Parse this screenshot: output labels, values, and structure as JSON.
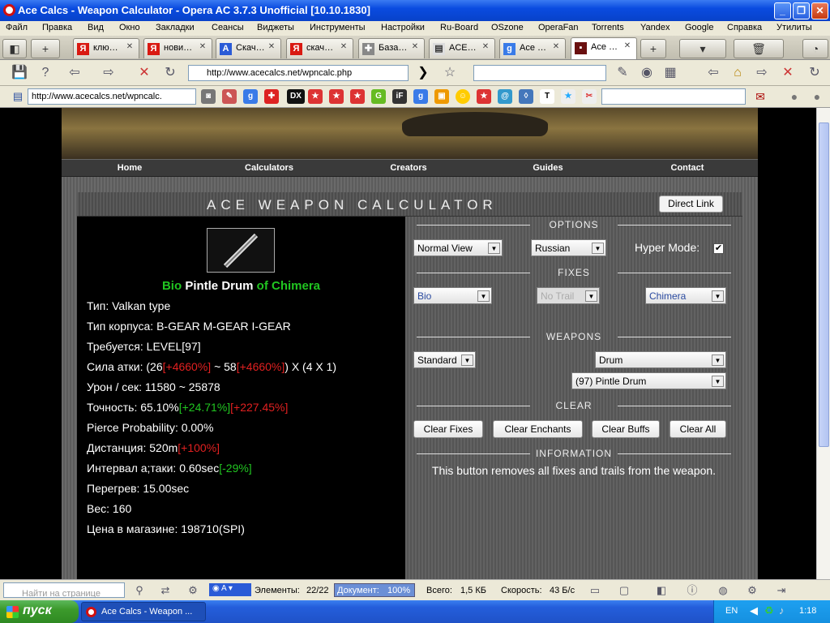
{
  "window": {
    "title": "Ace Calcs - Weapon Calculator - Opera AC 3.7.3 Unofficial [10.10.1830]"
  },
  "menu": [
    "Файл",
    "Правка",
    "Вид",
    "Окно",
    "Закладки",
    "Сеансы",
    "Виджеты",
    "Инструменты",
    "Настройки",
    "Ru-Board",
    "OSzone",
    "OperaFan",
    "Torrents",
    "Yandex",
    "Google",
    "Справка",
    "Утилиты"
  ],
  "tabs": [
    {
      "label": "клю…"
    },
    {
      "label": "нови…"
    },
    {
      "label": "Скач…"
    },
    {
      "label": "скач…"
    },
    {
      "label": "База…"
    },
    {
      "label": "ACE…"
    },
    {
      "label": "Ace …"
    },
    {
      "label": "Ace …"
    }
  ],
  "nav": {
    "url": "http://www.acecalcs.net/wpncalc.php",
    "search_value": ""
  },
  "linkbar": {
    "url": "http://www.acecalcs.net/wpncalc."
  },
  "site_nav": [
    "Home",
    "Calculators",
    "Creators",
    "Guides",
    "Contact"
  ],
  "calc": {
    "title": "ACE WEAPON CALCULATOR",
    "direct_link": "Direct Link"
  },
  "item": {
    "prefix": "Bio",
    "name": "Pintle Drum",
    "suffix": "of Chimera",
    "lines": {
      "type": "Тип: Valkan type",
      "hull": "Тип корпуса: B-GEAR M-GEAR I-GEAR",
      "req": "Требуется: LEVEL[97]",
      "atk_a": "Сила атки: (26",
      "atk_b": "[+4660%]",
      "atk_c": " ~ 58",
      "atk_d": "[+4660%]",
      "atk_e": ") X (4 X 1)",
      "dps": "Урон / сек: 11580 ~ 25878",
      "acc_a": "Точность: 65.10%",
      "acc_b": "[+24.71%]",
      "acc_c": "[+227.45%]",
      "pierce": "Pierce Probability: 0.00%",
      "range_a": "Дистанция: 520m",
      "range_b": "[+100%]",
      "int_a": "Интервал а;таки: 0.60sec",
      "int_b": "[-29%]",
      "over": "Перегрев: 15.00sec",
      "weight": "Вес: 160",
      "price": "Цена в магазине: 198710(SPI)"
    }
  },
  "options": {
    "section": "OPTIONS",
    "view": "Normal View",
    "lang": "Russian",
    "hyper_label": "Hyper Mode:"
  },
  "fixes": {
    "section": "FIXES",
    "prefix": "Bio",
    "trail": "No Trail",
    "suffix": "Chimera"
  },
  "weapons": {
    "section": "WEAPONS",
    "grade": "Standard",
    "class": "Drum",
    "weapon": "(97) Pintle Drum"
  },
  "clear": {
    "section": "CLEAR",
    "fixes": "Clear Fixes",
    "enchants": "Clear Enchants",
    "buffs": "Clear Buffs",
    "all": "Clear All"
  },
  "info": {
    "section": "INFORMATION",
    "text": "This button removes all fixes and trails from the weapon."
  },
  "status": {
    "find_placeholder": "Найти на странице",
    "elements_label": "Элементы:",
    "elements": "22/22",
    "doc_label": "Документ:",
    "doc": "100%",
    "total_label": "Всего:",
    "total": "1,5 КБ",
    "speed_label": "Скорость:",
    "speed": "43 Б/с"
  },
  "taskbar": {
    "start": "пуск",
    "item": "Ace Calcs - Weapon ...",
    "lang": "EN",
    "clock": "1:18"
  }
}
